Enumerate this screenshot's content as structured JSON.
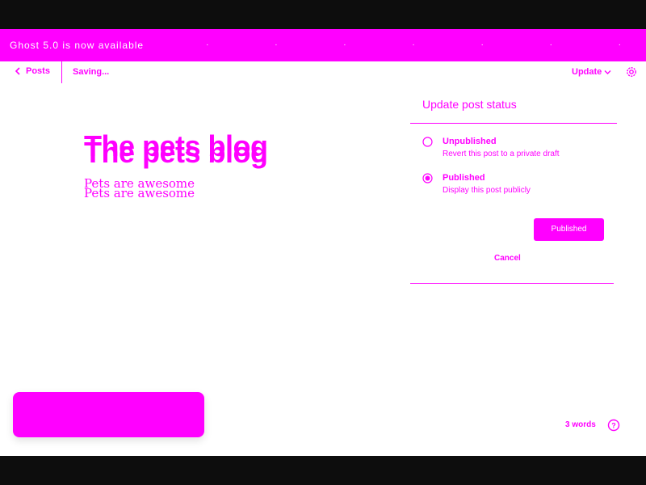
{
  "banner": {
    "text": "Ghost 5.0 is now available",
    "trail": [
      "·",
      "·",
      "·",
      "·",
      "·",
      "·",
      "·",
      "·"
    ]
  },
  "topbar": {
    "back_label": "Posts",
    "status": "Saving...",
    "update_label": "Update"
  },
  "post": {
    "title": "The pets blog",
    "subtitle": "Pets are awesome"
  },
  "status_panel": {
    "title": "Update post status",
    "options": [
      {
        "label": "Unpublished",
        "description": "Revert this post to a private draft",
        "selected": false
      },
      {
        "label": "Published",
        "description": "Display this post publicly",
        "selected": true
      }
    ],
    "cancel_label": "Cancel",
    "confirm_label": "Published"
  },
  "footer": {
    "word_count": "3 words"
  },
  "colors": {
    "accent": "#ff00ff",
    "background": "#ffffff"
  },
  "icons": {
    "back": "chevron-left-icon",
    "update": "chevron-down-icon",
    "settings": "gear-icon",
    "help": "question-circle-icon"
  }
}
